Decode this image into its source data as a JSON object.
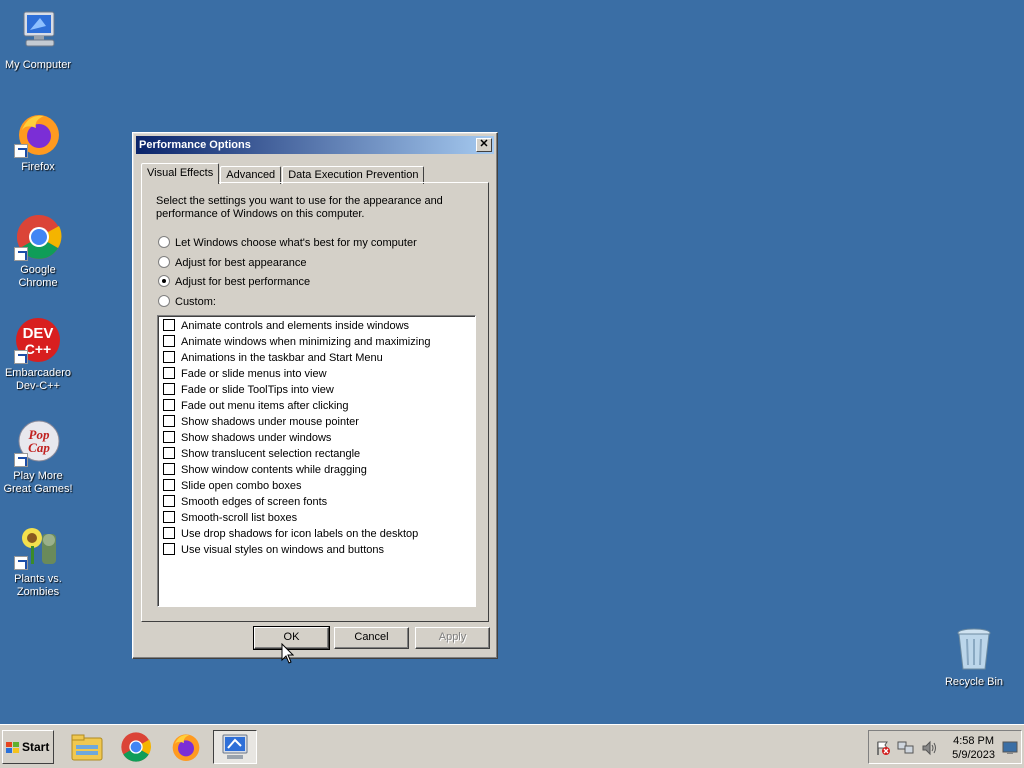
{
  "desktop": {
    "icons": [
      {
        "label": "My Computer"
      },
      {
        "label": "Firefox"
      },
      {
        "label": "Google Chrome"
      },
      {
        "label": "Embarcadero Dev-C++"
      },
      {
        "label": "Play More Great Games!"
      },
      {
        "label": "Plants vs. Zombies"
      },
      {
        "label": "Recycle Bin"
      }
    ]
  },
  "dialog": {
    "title": "Performance Options",
    "close_label": "✕",
    "tabs": [
      {
        "label": "Visual Effects",
        "active": true
      },
      {
        "label": "Advanced",
        "active": false
      },
      {
        "label": "Data Execution Prevention",
        "active": false
      }
    ],
    "description": "Select the settings you want to use for the appearance and performance of Windows on this computer.",
    "radios": [
      {
        "label": "Let Windows choose what's best for my computer",
        "checked": false
      },
      {
        "label": "Adjust for best appearance",
        "checked": false
      },
      {
        "label": "Adjust for best performance",
        "checked": true
      },
      {
        "label": "Custom:",
        "checked": false
      }
    ],
    "checkboxes": [
      {
        "label": "Animate controls and elements inside windows",
        "checked": false
      },
      {
        "label": "Animate windows when minimizing and maximizing",
        "checked": false
      },
      {
        "label": "Animations in the taskbar and Start Menu",
        "checked": false
      },
      {
        "label": "Fade or slide menus into view",
        "checked": false
      },
      {
        "label": "Fade or slide ToolTips into view",
        "checked": false
      },
      {
        "label": "Fade out menu items after clicking",
        "checked": false
      },
      {
        "label": "Show shadows under mouse pointer",
        "checked": false
      },
      {
        "label": "Show shadows under windows",
        "checked": false
      },
      {
        "label": "Show translucent selection rectangle",
        "checked": false
      },
      {
        "label": "Show window contents while dragging",
        "checked": false
      },
      {
        "label": "Slide open combo boxes",
        "checked": false
      },
      {
        "label": "Smooth edges of screen fonts",
        "checked": false
      },
      {
        "label": "Smooth-scroll list boxes",
        "checked": false
      },
      {
        "label": "Use drop shadows for icon labels on the desktop",
        "checked": false
      },
      {
        "label": "Use visual styles on windows and buttons",
        "checked": false
      }
    ],
    "buttons": {
      "ok": "OK",
      "cancel": "Cancel",
      "apply": "Apply"
    }
  },
  "taskbar": {
    "start_label": "Start",
    "apps": [
      "file-explorer-icon",
      "chrome-icon",
      "firefox-icon",
      "performance-options-icon"
    ],
    "time": "4:58 PM",
    "date": "5/9/2023"
  },
  "colors": {
    "desktop": "#3a6ea5",
    "title_start": "#0a246a",
    "title_end": "#a6caf0",
    "face": "#d4d0c8"
  }
}
